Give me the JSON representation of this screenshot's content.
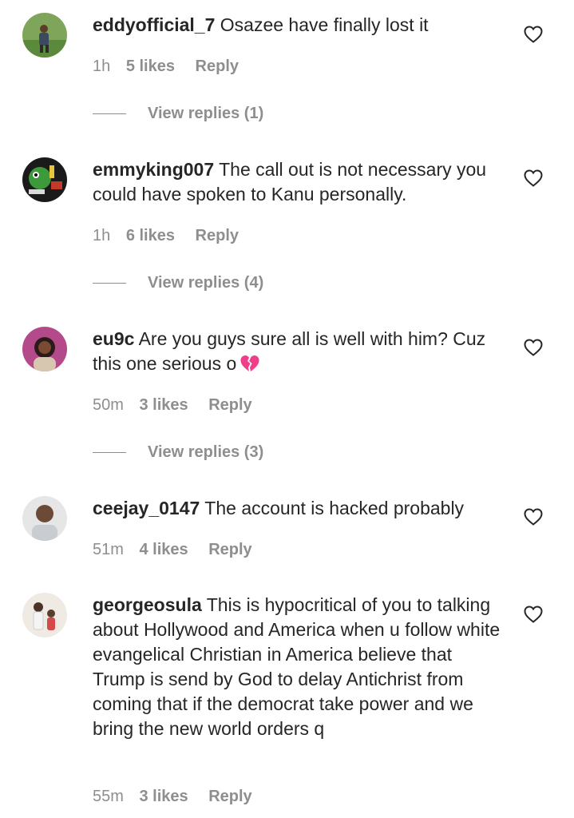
{
  "colors": {
    "text": "#262626",
    "secondary": "#8e8e8e",
    "background": "#ffffff"
  },
  "comments": [
    {
      "username": "eddyofficial_7",
      "text": "Osazee have finally lost it",
      "time": "1h",
      "likes": "5 likes",
      "reply_label": "Reply",
      "view_replies": "View replies (1)",
      "avatar_icon": "avatar-photo"
    },
    {
      "username": "emmyking007",
      "text": "The call out is not necessary you could have spoken to Kanu personally.",
      "time": "1h",
      "likes": "6 likes",
      "reply_label": "Reply",
      "view_replies": "View replies (4)",
      "avatar_icon": "avatar-photo"
    },
    {
      "username": "eu9c",
      "text": "Are you guys sure all is well with him? Cuz this one serious o",
      "emoji": "broken-heart-icon",
      "time": "50m",
      "likes": "3 likes",
      "reply_label": "Reply",
      "view_replies": "View replies (3)",
      "avatar_icon": "avatar-photo"
    },
    {
      "username": "ceejay_0147",
      "text": "The account is hacked probably",
      "time": "51m",
      "likes": "4 likes",
      "reply_label": "Reply",
      "avatar_icon": "avatar-photo"
    },
    {
      "username": "georgeosula",
      "text": "This is hypocritical of you to talking about Hollywood and America when u follow white evangelical Christian in America believe that Trump is send by God to delay Antichrist from coming that if the democrat take power and we bring the new world orders q",
      "time": "55m",
      "likes": "3 likes",
      "reply_label": "Reply",
      "avatar_icon": "avatar-photo"
    }
  ]
}
